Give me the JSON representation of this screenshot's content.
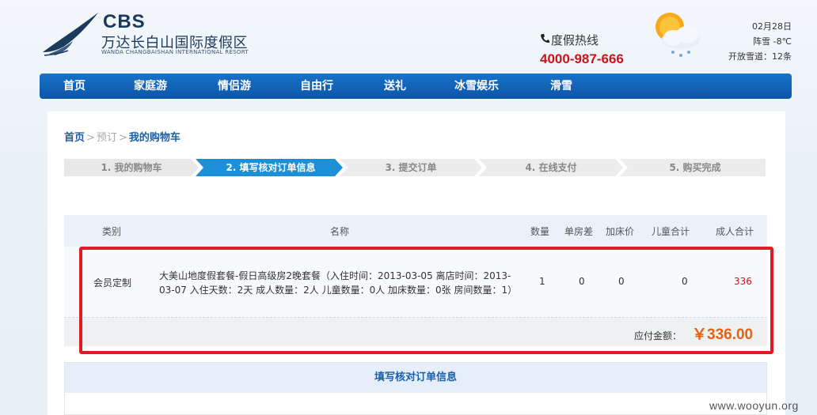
{
  "header": {
    "logo_cbs": "CBS",
    "logo_cn": "万达长白山国际度假区",
    "logo_en": "WANDA CHANGBAISHAN INTERNATIONAL RESORT",
    "hotline_label": "度假热线",
    "hotline_number": "4000-987-666",
    "weather_date": "02月28日",
    "weather_condition": "阵雪 -8℃",
    "weather_trails": "开放雪道：12条"
  },
  "nav": {
    "items": [
      "首页",
      "家庭游",
      "情侣游",
      "自由行",
      "送礼",
      "冰雪娱乐",
      "滑雪"
    ]
  },
  "breadcrumb": {
    "home": "首页",
    "book": "预订",
    "current": "我的购物车",
    "sep": ">"
  },
  "steps": [
    "1. 我的购物车",
    "2. 填写核对订单信息",
    "3. 提交订单",
    "4. 在线支付",
    "5. 购买完成"
  ],
  "active_step": 2,
  "table": {
    "headers": [
      "类别",
      "名称",
      "数量",
      "单房差",
      "加床价",
      "儿童合计",
      "成人合计"
    ],
    "row": {
      "category": "会员定制",
      "name": "大美山地度假套餐-假日高级房2晚套餐（入住时间：2013-03-05 离店时间：2013-03-07 入住天数：2天 成人数量：2人 儿童数量：0人 加床数量：0张 房间数量：1）",
      "qty": "1",
      "single_supp": "0",
      "extra_bed": "0",
      "child_total": "0",
      "adult_total": "336"
    },
    "total_label": "应付金额：",
    "total_amount": "￥336.00"
  },
  "section": {
    "title": "填写核对订单信息"
  },
  "watermark": "www.wooyun.org",
  "colors": {
    "nav": "#1565b8",
    "active_step": "#1c8fd6",
    "price": "#e8620e",
    "hotline": "#c8141a",
    "highlight": "#e01b24"
  }
}
